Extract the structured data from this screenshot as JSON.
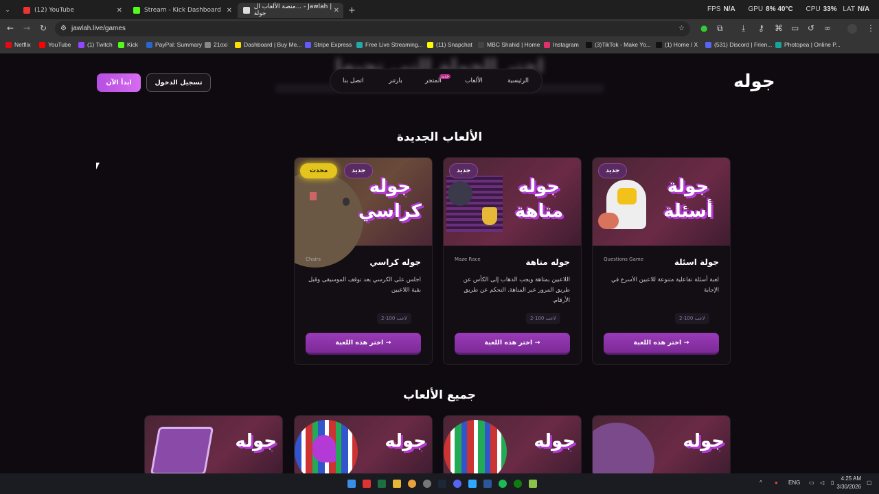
{
  "tabs": [
    {
      "label": "(12) YouTube",
      "color": "#e33"
    },
    {
      "label": "Stream - Kick Dashboard",
      "color": "#53fc18"
    },
    {
      "label": "منصة الألعاب ال... - Jawlah | جولة",
      "color": "#ddd"
    }
  ],
  "new_tab": "+",
  "perf": {
    "fps_label": "FPS",
    "fps": "N/A",
    "gpu_label": "GPU",
    "gpu_pct": "8%",
    "gpu_temp": "40°C",
    "cpu_label": "CPU",
    "cpu_pct": "33%",
    "lat_label": "LAT",
    "lat": "N/A"
  },
  "url": "jawlah.live/games",
  "bookmarks": [
    {
      "label": "Netflix",
      "color": "#e50914"
    },
    {
      "label": "YouTube",
      "color": "#ff0000"
    },
    {
      "label": "(1) Twitch",
      "color": "#9146ff"
    },
    {
      "label": "Kick",
      "color": "#53fc18"
    },
    {
      "label": "PayPal: Summary",
      "color": "#2a66c9"
    },
    {
      "label": "21oxi",
      "color": "#888"
    },
    {
      "label": "Dashboard | Buy Me...",
      "color": "#ffdd00"
    },
    {
      "label": "Stripe Express",
      "color": "#635bff"
    },
    {
      "label": "Free Live Streaming...",
      "color": "#2aa"
    },
    {
      "label": "(11) Snapchat",
      "color": "#fffc00"
    },
    {
      "label": "MBC Shahid | Home",
      "color": "#444"
    },
    {
      "label": "Instagram",
      "color": "#e1306c"
    },
    {
      "label": "(3)TikTok - Make Yo...",
      "color": "#111"
    },
    {
      "label": "(1) Home / X",
      "color": "#111"
    },
    {
      "label": "(531) Discord | Frien...",
      "color": "#5865f2"
    },
    {
      "label": "Photopea | Online P...",
      "color": "#18a497"
    }
  ],
  "site": {
    "logo": "جوله",
    "nav": [
      "الرئيسية",
      "الألعاب",
      "المتجر",
      "بارتنر",
      "اتصل بنا"
    ],
    "nav_new_tag": "جديد",
    "login": "تسجيل الدخول",
    "start": "ابدأ الآن",
    "hero_blurred": "اختر الجولة التي تحبها"
  },
  "new_games_title": "الألعاب الجديدة",
  "new_games": [
    {
      "image_title": "جولة أسئلة",
      "badge": "جديد",
      "name": "جولة اسئلة",
      "en": "Questions Game",
      "desc": "لعبة أسئلة تفاعلية متنوعة للاعبين الأسرع في الإجابة",
      "players": "2-100 لاعب",
      "button": "اختر هذه اللعبة"
    },
    {
      "image_title": "جوله متاهة",
      "badge": "جديد",
      "name": "جوله متاهة",
      "en": "Maze Race",
      "desc": "اللاعبين بمتاهة ويجب الذهاب إلى الكأس عن طريق المرور عبر المتاهة. التحكم عن طريق الأرقام.",
      "players": "2-100 لاعب",
      "button": "اختر هذه اللعبة"
    },
    {
      "image_title": "جوله كراسي",
      "badge": "جديد",
      "badge2": "محدث",
      "name": "جوله كراسي",
      "en": "Chairs",
      "desc": "اجلس على الكرسي بعد توقف الموسيقى وقبل بقية اللاعبين",
      "players": "2-100 لاعب",
      "button": "اختر هذه اللعبة"
    }
  ],
  "all_games_title": "جميع الألعاب",
  "all_games": [
    {
      "image_title": "جوله"
    },
    {
      "image_title": "جوله"
    },
    {
      "image_title": "جوله"
    },
    {
      "image_title": "جوله"
    }
  ],
  "taskbar": {
    "lang": "ENG",
    "time": "4:25 AM",
    "date": "3/30/2026"
  }
}
